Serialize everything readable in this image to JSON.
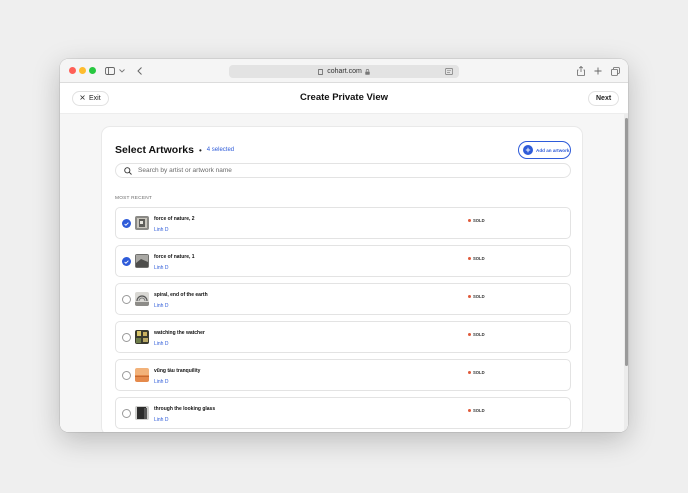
{
  "browser": {
    "url": "cohart.com"
  },
  "header": {
    "exit_label": "Exit",
    "title": "Create Private View",
    "next_label": "Next"
  },
  "select": {
    "title": "Select Artworks",
    "separator": "•",
    "selected_count": "4 selected",
    "add_button": "Add an artwork",
    "search_placeholder": "Search by artist or artwork name",
    "section_label": "MOST RECENT"
  },
  "artworks": [
    {
      "title": "force of nature, 2",
      "artist": "Linh D",
      "status": "SOLD",
      "selected": true
    },
    {
      "title": "force of nature, 1",
      "artist": "Linh D",
      "status": "SOLD",
      "selected": true
    },
    {
      "title": "spiral, end of the earth",
      "artist": "Linh D",
      "status": "SOLD",
      "selected": false
    },
    {
      "title": "watching the watcher",
      "artist": "Linh D",
      "status": "SOLD",
      "selected": false
    },
    {
      "title": "vũng tàu tranquility",
      "artist": "Linh D",
      "status": "SOLD",
      "selected": false
    },
    {
      "title": "through the looking glass",
      "artist": "Linh D",
      "status": "SOLD",
      "selected": false
    }
  ],
  "colors": {
    "accent": "#2e5bd9",
    "sold_dot": "#e05a3a"
  },
  "icons": {
    "exit": "close-icon",
    "add": "plus-icon",
    "search": "search-icon",
    "selected": "check-icon"
  }
}
